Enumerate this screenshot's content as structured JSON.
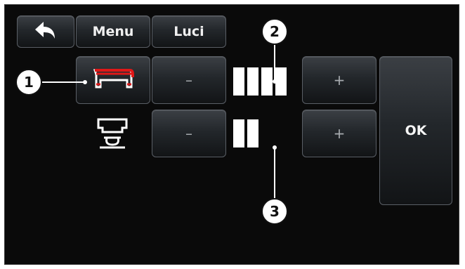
{
  "header": {
    "back_icon": "back-arrow-icon",
    "menu_label": "Menu",
    "luci_label": "Luci"
  },
  "rows": [
    {
      "icon": "machine-light-strip-icon",
      "minus_label": "–",
      "plus_label": "+",
      "level_segments": 4
    },
    {
      "icon": "cup-tray-light-icon",
      "minus_label": "–",
      "plus_label": "+",
      "level_segments": 2
    }
  ],
  "ok_label": "OK",
  "callouts": {
    "c1": "1",
    "c2": "2",
    "c3": "3"
  },
  "colors": {
    "highlight_red": "#e01818",
    "background": "#0a0a0a"
  }
}
